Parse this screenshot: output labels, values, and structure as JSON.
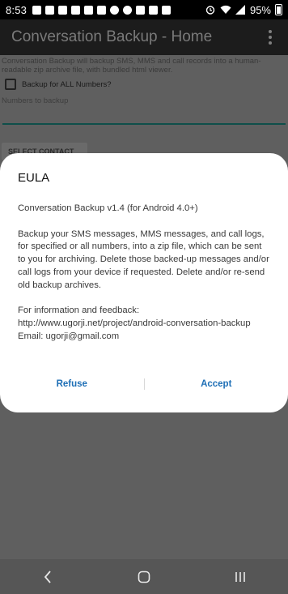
{
  "status_bar": {
    "time": "8:53",
    "battery": "95%",
    "notification_icons": [
      "gallery-icon",
      "facebook-icon",
      "facebook-icon",
      "youtube-icon",
      "youtube-icon",
      "linkedin-icon",
      "app-icon",
      "chrome-icon",
      "s-icon",
      "gallery-icon",
      "app-icon"
    ]
  },
  "app_bar": {
    "title": "Conversation Backup - Home"
  },
  "background": {
    "intro": "Conversation Backup will backup SMS, MMS and call records into a human-readable zip archive file, with bundled html viewer.",
    "backup_all_label": "Backup for ALL Numbers?",
    "numbers_label": "Numbers to backup",
    "select_contact_label": "SELECT CONTACT"
  },
  "dialog": {
    "title": "EULA",
    "version_line": "Conversation Backup v1.4 (for Android 4.0+)",
    "description": "Backup your SMS messages, MMS messages, and call logs, for specified or all numbers, into a zip file, which can be sent to you for archiving. Delete those backed-up messages and/or call logs from your device if requested. Delete and/or re-send old backup archives.",
    "info_line": "For information and feedback:",
    "url": "http://www.ugorji.net/project/android-conversation-backup",
    "email": "Email: ugorji@gmail.com",
    "refuse_label": "Refuse",
    "accept_label": "Accept"
  },
  "colors": {
    "accent": "#1e6fb6",
    "scrim": "#5f5f5f"
  }
}
